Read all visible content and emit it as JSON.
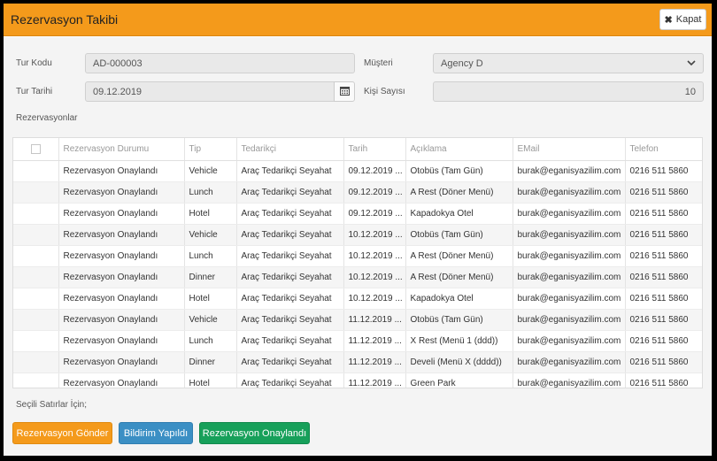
{
  "window": {
    "title": "Rezervasyon Takibi",
    "close_label": "Kapat"
  },
  "form": {
    "tour_code_label": "Tur Kodu",
    "tour_code_value": "AD-000003",
    "customer_label": "Müşteri",
    "customer_value": "Agency D",
    "tour_date_label": "Tur Tarihi",
    "tour_date_value": "09.12.2019",
    "pax_label": "Kişi Sayısı",
    "pax_value": "10"
  },
  "section_label": "Rezervasyonlar",
  "table": {
    "columns": [
      "",
      "Rezervasyon Durumu",
      "Tip",
      "Tedarikçi",
      "Tarih",
      "Açıklama",
      "EMail",
      "Telefon"
    ],
    "rows": [
      [
        "",
        "Rezervasyon Onaylandı",
        "Vehicle",
        "Araç Tedarikçi Seyahat",
        "09.12.2019 ...",
        "Otobüs (Tam Gün)",
        "burak@eganisyazilim.com",
        "0216 511 5860"
      ],
      [
        "",
        "Rezervasyon Onaylandı",
        "Lunch",
        "Araç Tedarikçi Seyahat",
        "09.12.2019 ...",
        "A Rest (Döner Menü)",
        "burak@eganisyazilim.com",
        "0216 511 5860"
      ],
      [
        "",
        "Rezervasyon Onaylandı",
        "Hotel",
        "Araç Tedarikçi Seyahat",
        "09.12.2019 ...",
        "Kapadokya Otel",
        "burak@eganisyazilim.com",
        "0216 511 5860"
      ],
      [
        "",
        "Rezervasyon Onaylandı",
        "Vehicle",
        "Araç Tedarikçi Seyahat",
        "10.12.2019 ...",
        "Otobüs (Tam Gün)",
        "burak@eganisyazilim.com",
        "0216 511 5860"
      ],
      [
        "",
        "Rezervasyon Onaylandı",
        "Lunch",
        "Araç Tedarikçi Seyahat",
        "10.12.2019 ...",
        "A Rest (Döner Menü)",
        "burak@eganisyazilim.com",
        "0216 511 5860"
      ],
      [
        "",
        "Rezervasyon Onaylandı",
        "Dinner",
        "Araç Tedarikçi Seyahat",
        "10.12.2019 ...",
        "A Rest (Döner Menü)",
        "burak@eganisyazilim.com",
        "0216 511 5860"
      ],
      [
        "",
        "Rezervasyon Onaylandı",
        "Hotel",
        "Araç Tedarikçi Seyahat",
        "10.12.2019 ...",
        "Kapadokya Otel",
        "burak@eganisyazilim.com",
        "0216 511 5860"
      ],
      [
        "",
        "Rezervasyon Onaylandı",
        "Vehicle",
        "Araç Tedarikçi Seyahat",
        "11.12.2019 ...",
        "Otobüs (Tam Gün)",
        "burak@eganisyazilim.com",
        "0216 511 5860"
      ],
      [
        "",
        "Rezervasyon Onaylandı",
        "Lunch",
        "Araç Tedarikçi Seyahat",
        "11.12.2019 ...",
        "X Rest (Menü 1 (ddd))",
        "burak@eganisyazilim.com",
        "0216 511 5860"
      ],
      [
        "",
        "Rezervasyon Onaylandı",
        "Dinner",
        "Araç Tedarikçi Seyahat",
        "11.12.2019 ...",
        "Develi (Menü X (dddd))",
        "burak@eganisyazilim.com",
        "0216 511 5860"
      ],
      [
        "",
        "Rezervasyon Onaylandı",
        "Hotel",
        "Araç Tedarikçi Seyahat",
        "11.12.2019 ...",
        "Green Park",
        "burak@eganisyazilim.com",
        "0216 511 5860"
      ]
    ]
  },
  "footer": {
    "selected_label": "Seçili Satırlar İçin;",
    "buttons": [
      {
        "label": "Rezervasyon Gönder",
        "color": "#f49a1b"
      },
      {
        "label": "Bildirim Yapıldı",
        "color": "#3b8fc4"
      },
      {
        "label": "Rezervasyon Onaylandı",
        "color": "#17a05a"
      }
    ]
  },
  "colors": {
    "header": "#f49a1b"
  }
}
